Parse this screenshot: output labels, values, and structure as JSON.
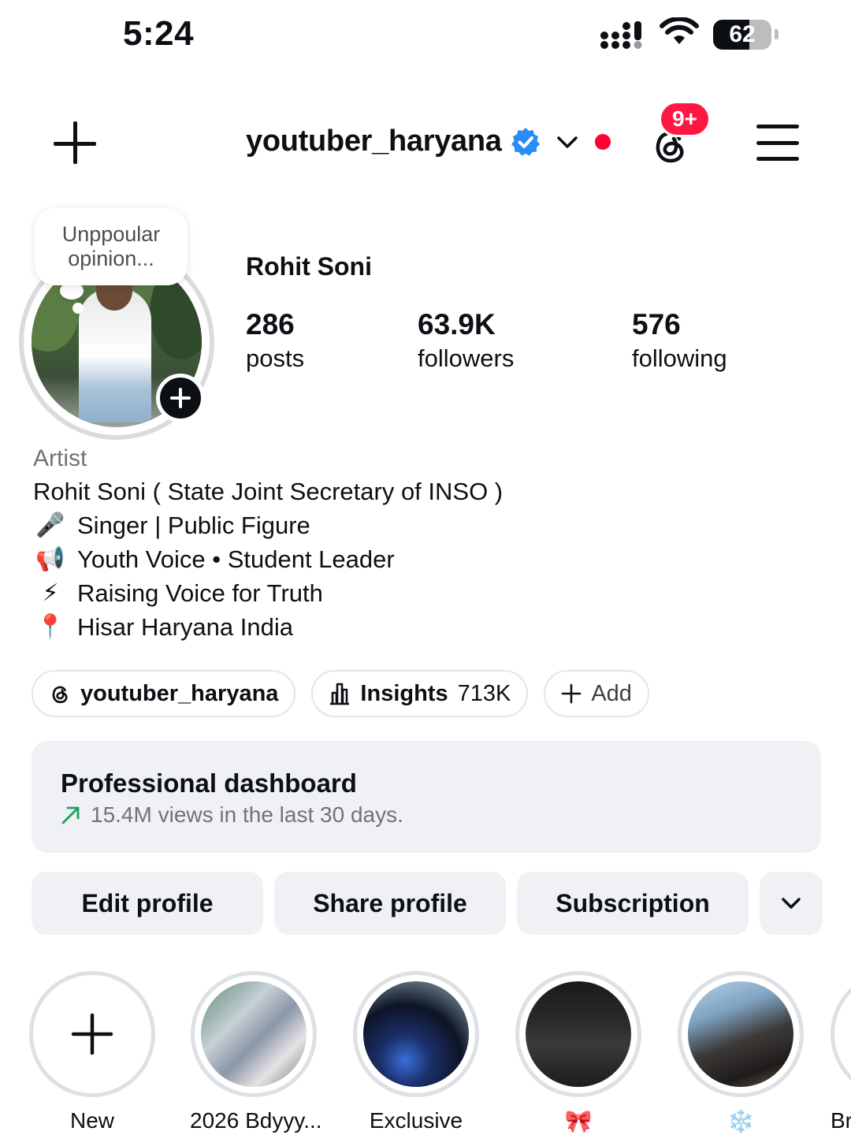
{
  "status_bar": {
    "time": "5:24",
    "battery": "62",
    "battery_level": 0.62
  },
  "header": {
    "username": "youtuber_haryana",
    "notification_count": "9+"
  },
  "profile": {
    "note": "Unppoular opinion...",
    "full_name": "Rohit Soni",
    "stats": [
      {
        "value": "286",
        "label": "posts"
      },
      {
        "value": "63.9K",
        "label": "followers"
      },
      {
        "value": "576",
        "label": "following"
      }
    ]
  },
  "bio": {
    "category": "Artist",
    "lines": [
      {
        "emoji": "",
        "text": "Rohit Soni ( State Joint Secretary of INSO )"
      },
      {
        "emoji": "🎤",
        "text": "Singer | Public Figure"
      },
      {
        "emoji": "📢",
        "text": "Youth Voice • Student Leader"
      },
      {
        "emoji": "⚡",
        "text": "Raising Voice for Truth"
      },
      {
        "emoji": "📍",
        "text": "Hisar Haryana India"
      }
    ]
  },
  "pills": {
    "threads": "youtuber_haryana",
    "insights_label": "Insights",
    "insights_value": "713K",
    "add": "Add"
  },
  "dashboard": {
    "title": "Professional dashboard",
    "subtitle": "15.4M views in the last 30 days."
  },
  "actions": {
    "edit": "Edit profile",
    "share": "Share profile",
    "subscription": "Subscription"
  },
  "highlights": [
    {
      "label": "New"
    },
    {
      "label": "2026 Bdyyy..."
    },
    {
      "label": "Exclusive"
    },
    {
      "label": "🎀"
    },
    {
      "label": "❄️"
    },
    {
      "label": "Br"
    }
  ],
  "colors": {
    "accent_red": "#ff1744",
    "verified_blue": "#2a8cf5",
    "text": "#0c1014",
    "muted": "#737373",
    "surface": "#eff1f4"
  },
  "icons": [
    "plus-icon",
    "verified-icon",
    "chevron-down-icon",
    "threads-icon",
    "menu-icon",
    "insights-icon",
    "trend-arrow-icon"
  ]
}
